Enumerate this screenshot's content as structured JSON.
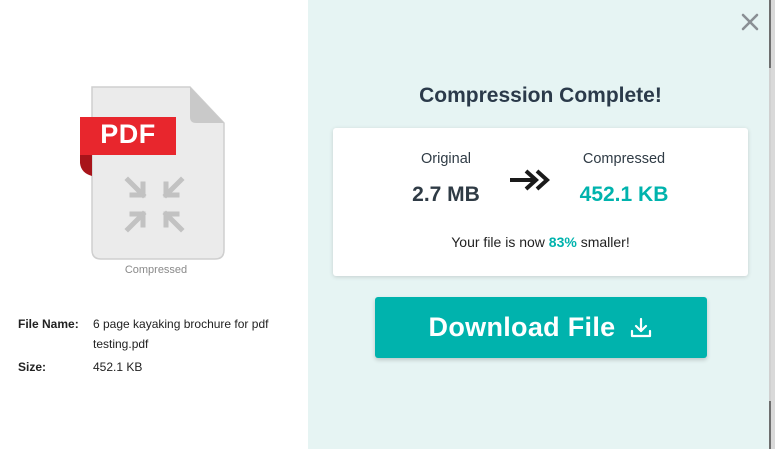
{
  "colors": {
    "accent": "#00b3ad",
    "pdf_badge": "#e8262d",
    "right_panel_bg": "#e6f4f3",
    "heading_text": "#2b3a4a"
  },
  "file_preview": {
    "badge_text": "PDF",
    "icon": "compress-arrows-icon",
    "caption": "Compressed"
  },
  "file_info": [
    {
      "key": "File Name:",
      "value": "6 page kayaking brochure for pdf testing.pdf"
    },
    {
      "key": "Size:",
      "value": "452.1 KB"
    }
  ],
  "close_icon": "close-icon",
  "result": {
    "title": "Compression Complete!",
    "original_label": "Original",
    "original_value": "2.7 MB",
    "arrow_icon": "double-arrow-right-icon",
    "compressed_label": "Compressed",
    "compressed_value": "452.1 KB",
    "summary_prefix": "Your file is now ",
    "summary_percent": "83%",
    "summary_suffix": " smaller!"
  },
  "download": {
    "label": "Download File",
    "icon": "download-icon"
  }
}
